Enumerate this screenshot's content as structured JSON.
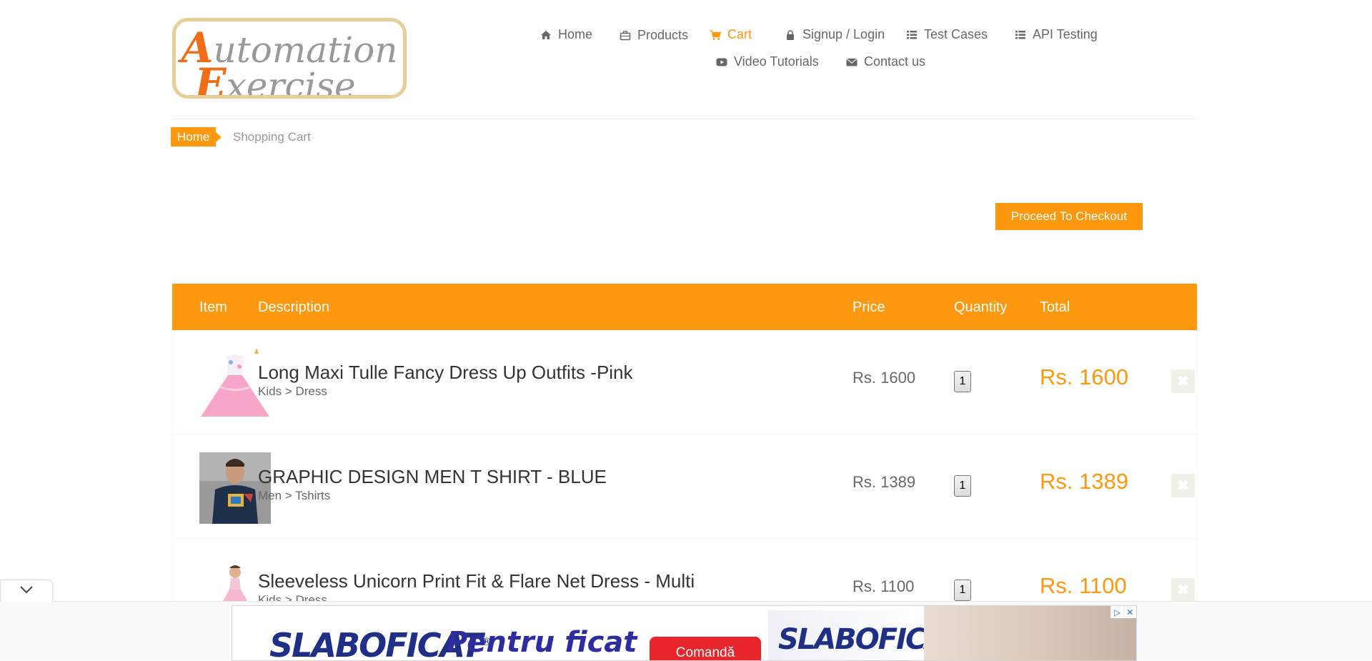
{
  "logo": {
    "line1_big": "A",
    "line1_rest": "utomation",
    "line2_big": "E",
    "line2_rest": "xercise"
  },
  "nav": {
    "home": "Home",
    "products": "Products",
    "cart": "Cart",
    "signup_login": "Signup / Login",
    "test_cases": "Test Cases",
    "api_testing": "API Testing",
    "video_tutorials": "Video Tutorials",
    "contact_us": "Contact us"
  },
  "breadcrumb": {
    "home": "Home",
    "current": "Shopping Cart"
  },
  "checkout_button": "Proceed To Checkout",
  "table": {
    "headers": {
      "item": "Item",
      "description": "Description",
      "price": "Price",
      "quantity": "Quantity",
      "total": "Total"
    },
    "rows": [
      {
        "name": "Long Maxi Tulle Fancy Dress Up Outfits -Pink",
        "category": "Kids > Dress",
        "price": "Rs. 1600",
        "quantity": "1",
        "total": "Rs. 1600"
      },
      {
        "name": "GRAPHIC DESIGN MEN T SHIRT - BLUE",
        "category": "Men > Tshirts",
        "price": "Rs. 1389",
        "quantity": "1",
        "total": "Rs. 1389"
      },
      {
        "name": "Sleeveless Unicorn Print Fit & Flare Net Dress - Multi",
        "category": "Kids > Dress",
        "price": "Rs. 1100",
        "quantity": "1",
        "total": "Rs. 1100"
      }
    ]
  },
  "ad": {
    "brand": "SLABOFICAT",
    "brand_mark": "®",
    "tagline": "Pentru ficat",
    "cta": "Comandă",
    "product_label": "SLABOFICAT"
  },
  "colors": {
    "accent": "#fe980f",
    "text": "#696763",
    "ad_blue": "#1f2f86",
    "ad_red": "#e8262b"
  }
}
